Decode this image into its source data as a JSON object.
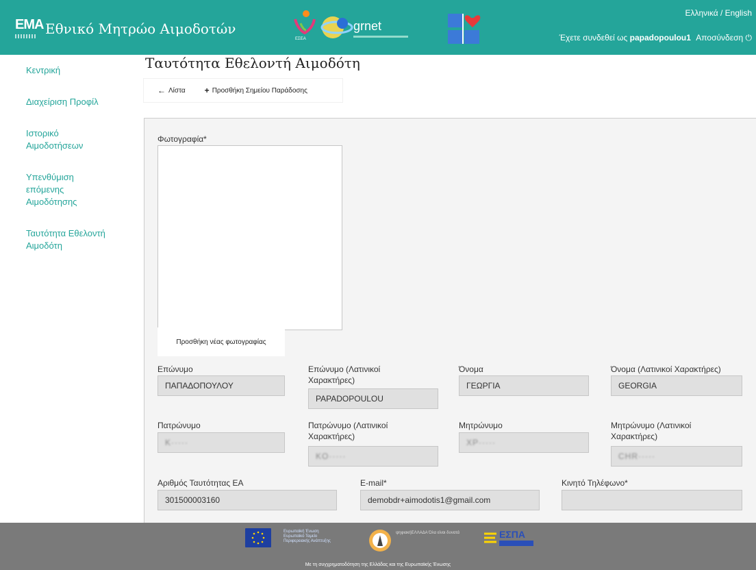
{
  "header": {
    "brand_logo_text": "ΕΜΑ",
    "title": "Εθνικό Μητρώο Αιμοδοτών",
    "grnet_text": "grnet",
    "lang": "Ελληνικά / English",
    "login_prefix": "Έχετε συνδεθεί ως",
    "username": "papadopoulou1",
    "logout": "Αποσύνδεση",
    "accent": "#24a59a"
  },
  "sidebar": {
    "items": [
      {
        "label": "Κεντρική"
      },
      {
        "label": "Διαχείριση Προφίλ"
      },
      {
        "label": "Ιστορικό Αιμοδοτήσεων"
      },
      {
        "label": "Υπενθύμιση επόμενης Αιμοδότησης"
      },
      {
        "label": "Ταυτότητα Εθελοντή Αιμοδότη"
      }
    ]
  },
  "main": {
    "title": "Ταυτότητα Εθελοντή Αιμοδότη",
    "toolbar": {
      "list_label": "Λίστα",
      "add_label": "Προσθήκη Σημείου Παράδοσης"
    },
    "photo_label": "Φωτογραφία*",
    "photo_button": "Προσθήκη νέας φωτογραφίας",
    "fields": {
      "surname": {
        "label": "Επώνυμο",
        "value": "ΠΑΠΑΔΟΠΟΥΛΟΥ"
      },
      "surname_latin": {
        "label": "Επώνυμο (Λατινικοί Χαρακτήρες)",
        "value": "PAPADOPOULOU"
      },
      "name": {
        "label": "Όνομα",
        "value": "ΓΕΩΡΓΙΑ"
      },
      "name_latin": {
        "label": "Όνομα (Λατινικοί Χαρακτήρες)",
        "value": "GEORGIA"
      },
      "father": {
        "label": "Πατρώνυμο",
        "value": "Κ·····"
      },
      "father_latin": {
        "label": "Πατρώνυμο (Λατινικοί Χαρακτήρες)",
        "value": "KO·····"
      },
      "mother": {
        "label": "Μητρώνυμο",
        "value": "ΧΡ·····"
      },
      "mother_latin": {
        "label": "Μητρώνυμο (Λατινικοί Χαρακτήρες)",
        "value": "CHR·····"
      },
      "id_number": {
        "label": "Αριθμός Ταυτότητας ΕΑ",
        "value": "301500003160"
      },
      "email": {
        "label": "E-mail*",
        "value": "demobdr+aimodotis1@gmail.com"
      },
      "mobile": {
        "label": "Κινητό Τηλέφωνο*",
        "value": ""
      }
    }
  },
  "footer": {
    "eu_text": "Ευρωπαϊκή Ένωση Ευρωπαϊκό Ταμείο Περιφερειακής Ανάπτυξης",
    "digital_text": "ψηφιακήΕΛΛΑΔΑ Όλα είναι δυνατά",
    "espa_text": "ΕΣΠΑ",
    "note": "Με τη συγχρηματοδότηση της Ελλάδας και της Ευρωπαϊκής Ένωσης"
  }
}
